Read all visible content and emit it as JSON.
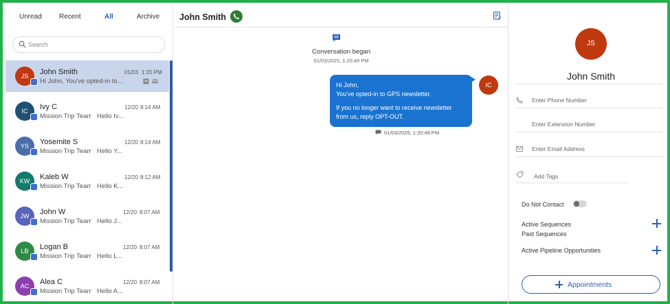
{
  "tabs": [
    {
      "label": "Unread"
    },
    {
      "label": "Recent"
    },
    {
      "label": "All"
    },
    {
      "label": "Archive"
    }
  ],
  "search": {
    "placeholder": "Search"
  },
  "conversations": [
    {
      "initials": "JS",
      "color": "#c0390f",
      "name": "John Smith",
      "group": "",
      "preview": "Hi John,  You've opted-in to...",
      "date": "01/03",
      "time": "1:20 PM",
      "selected": true
    },
    {
      "initials": "IC",
      "color": "#1f5071",
      "name": "Ivy C",
      "group": "Mission Trip Team",
      "preview": "Hello Iv...",
      "date": "12/20",
      "time": "8:14 AM"
    },
    {
      "initials": "YS",
      "color": "#4a6ea8",
      "name": "Yosemite S",
      "group": "Mission Trip Team",
      "preview": "Hello Y...",
      "date": "12/20",
      "time": "8:14 AM"
    },
    {
      "initials": "KW",
      "color": "#147a6c",
      "name": "Kaleb W",
      "group": "Mission Trip Team",
      "preview": "Hello K...",
      "date": "12/20",
      "time": "8:12 AM"
    },
    {
      "initials": "JW",
      "color": "#5a64b8",
      "name": "John W",
      "group": "Mission Trip Team",
      "preview": "Hello J...",
      "date": "12/20",
      "time": "8:07 AM"
    },
    {
      "initials": "LB",
      "color": "#2f8a45",
      "name": "Logan B",
      "group": "Mission Trip Team",
      "preview": "Hello L...",
      "date": "12/20",
      "time": "8:07 AM"
    },
    {
      "initials": "AC",
      "color": "#8a3fb0",
      "name": "Alea C",
      "group": "Mission Trip Team",
      "preview": "Hello A...",
      "date": "12/20",
      "time": "8:07 AM"
    }
  ],
  "chat": {
    "title": "John Smith",
    "event_text": "Conversation began",
    "event_time": "01/03/2025, 1:20:49 PM",
    "message_lines": [
      "Hi John,",
      "You've opted-in to GPS newsletter.",
      "",
      "If you no longer want to receive newsletter",
      "from us, reply OPT-OUT."
    ],
    "sender_initials": "IC",
    "message_time": "01/03/2025, 1:20:49 PM"
  },
  "contact": {
    "initials": "JS",
    "name": "John Smith",
    "phone_placeholder": "Enter Phone Number",
    "extension_placeholder": "Enter Extension Number",
    "email_placeholder": "Enter Email Address",
    "tags_placeholder": "Add Tags",
    "do_not_contact_label": "Do Not Contact",
    "do_not_contact": false,
    "active_sequences_label": "Active Sequences",
    "past_sequences_label": "Past Sequences",
    "pipeline_label": "Active Pipeline Opportunities",
    "appointments_label": "Appointments"
  },
  "colors": {
    "accent": "#2a5db0",
    "bubble": "#1a73d1",
    "call": "#2e7d32",
    "border": "#22b24c"
  }
}
